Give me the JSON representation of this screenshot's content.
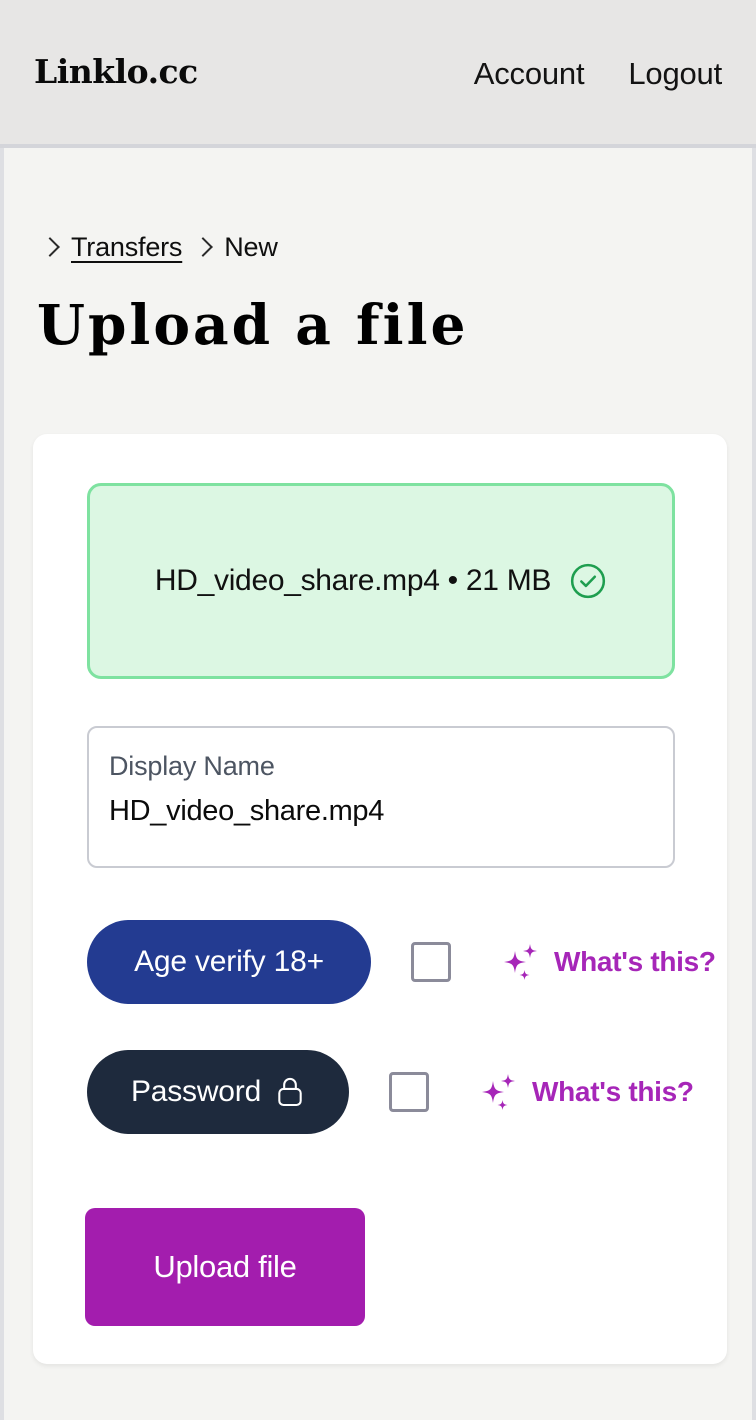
{
  "header": {
    "brand": "Linklo.cc",
    "nav": [
      {
        "label": "Account",
        "name": "nav-account"
      },
      {
        "label": "Logout",
        "name": "nav-logout"
      }
    ]
  },
  "breadcrumb": {
    "parent": "Transfers",
    "current": "New"
  },
  "main": {
    "title": "Upload a file",
    "dropzone": {
      "file_summary": "HD_video_share.mp4 • 21 MB",
      "file_name": "HD_video_share.mp4",
      "file_size": "21 MB",
      "status_icon": "check-circle-icon",
      "border_color": "#7ee2a0",
      "background_color": "#dcf7e3"
    },
    "display_name_field": {
      "label": "Display Name",
      "value": "HD_video_share.mp4",
      "placeholder": "Display Name"
    },
    "options": [
      {
        "pill_label": "Age verify 18+",
        "pill_color": "#233b91",
        "checked": false,
        "help_label": "What's this?",
        "help_color": "#a626b8",
        "help_icon": "sparkles-icon"
      },
      {
        "pill_label": "Password",
        "pill_icon": "lock-icon",
        "pill_color": "#1e2a3d",
        "checked": false,
        "help_label": "What's this?",
        "help_color": "#a626b8",
        "help_icon": "sparkles-icon"
      }
    ],
    "submit": {
      "label": "Upload file",
      "color": "#a31dae"
    }
  }
}
